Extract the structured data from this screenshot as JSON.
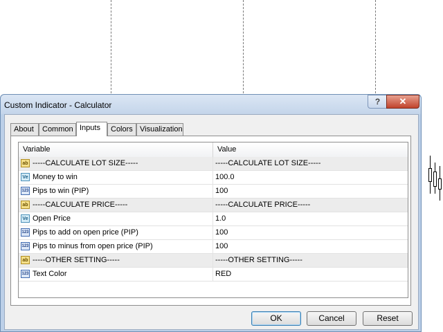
{
  "window": {
    "title": "Custom Indicator - Calculator",
    "help_label": "?",
    "close_label": "✕"
  },
  "tabs": [
    {
      "label": "About"
    },
    {
      "label": "Common"
    },
    {
      "label": "Inputs"
    },
    {
      "label": "Colors"
    },
    {
      "label": "Visualization"
    }
  ],
  "active_tab": "Inputs",
  "grid": {
    "columns": [
      "Variable",
      "Value"
    ],
    "rows": [
      {
        "icon": "ab",
        "variable": "-----CALCULATE LOT SIZE-----",
        "value": "-----CALCULATE LOT SIZE-----"
      },
      {
        "icon": "Ve",
        "variable": "Money to win",
        "value": "100.0"
      },
      {
        "icon": "123",
        "variable": "Pips to win (PIP)",
        "value": "100"
      },
      {
        "icon": "ab",
        "variable": "-----CALCULATE PRICE-----",
        "value": "-----CALCULATE PRICE-----"
      },
      {
        "icon": "Ve",
        "variable": "Open Price",
        "value": "1.0"
      },
      {
        "icon": "123",
        "variable": "Pips to add on open price (PIP)",
        "value": "100"
      },
      {
        "icon": "123",
        "variable": "Pips to minus from open price (PIP)",
        "value": "100"
      },
      {
        "icon": "ab",
        "variable": "-----OTHER SETTING-----",
        "value": "-----OTHER SETTING-----"
      },
      {
        "icon": "123",
        "variable": "Text Color",
        "value": "RED"
      }
    ]
  },
  "buttons": {
    "ok": "OK",
    "cancel": "Cancel",
    "reset": "Reset"
  },
  "colors": {
    "window_frame": "#bcd0e8",
    "close_button": "#c0432c"
  }
}
